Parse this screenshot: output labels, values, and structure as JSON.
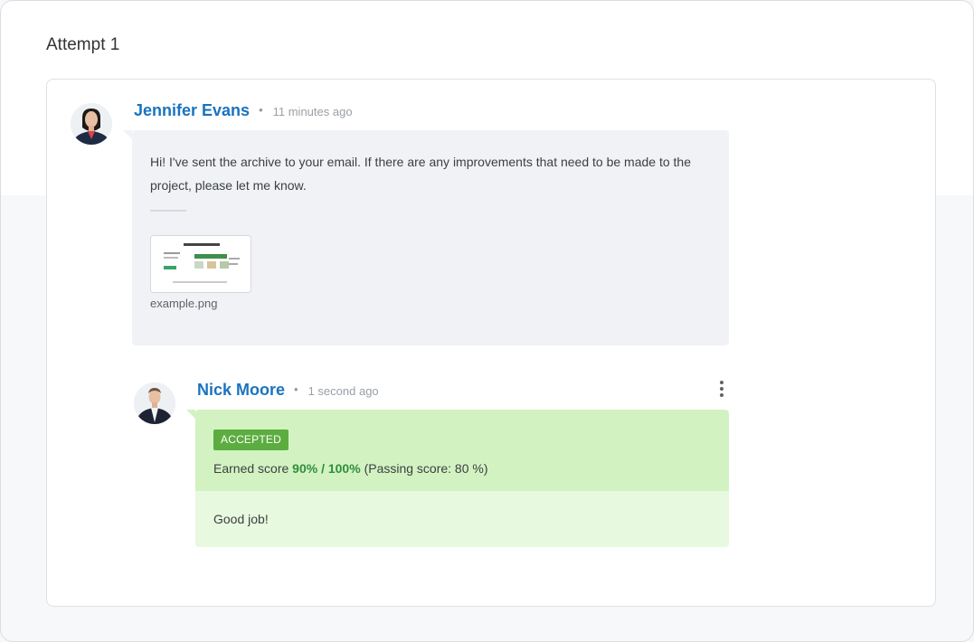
{
  "attempt": {
    "title": "Attempt 1"
  },
  "messages": [
    {
      "author": "Jennifer Evans",
      "separator": "•",
      "time": "11 minutes ago",
      "avatar_icon": "avatar-female-icon",
      "text": "Hi! I've sent the archive to your email. If there are any improvements that need to be made to the project, please let me know.",
      "attachment": {
        "file_name": "example.png",
        "icon": "image-thumbnail-icon"
      }
    },
    {
      "author": "Nick Moore",
      "separator": "•",
      "time": "1 second ago",
      "avatar_icon": "avatar-male-icon",
      "badge": "ACCEPTED",
      "score_prefix": "Earned score",
      "score_value": "90% / 100%",
      "score_suffix": "(Passing score: 80 %)",
      "comment": "Good job!",
      "menu_icon": "more-vertical-icon"
    }
  ],
  "colors": {
    "author": "#1a73c0",
    "accepted_badge": "#5cad3f",
    "score_value": "#2f8f3a",
    "review_top": "#d3f2c2",
    "review_bottom": "#e7f9de",
    "message_bubble": "#f0f2f6"
  }
}
